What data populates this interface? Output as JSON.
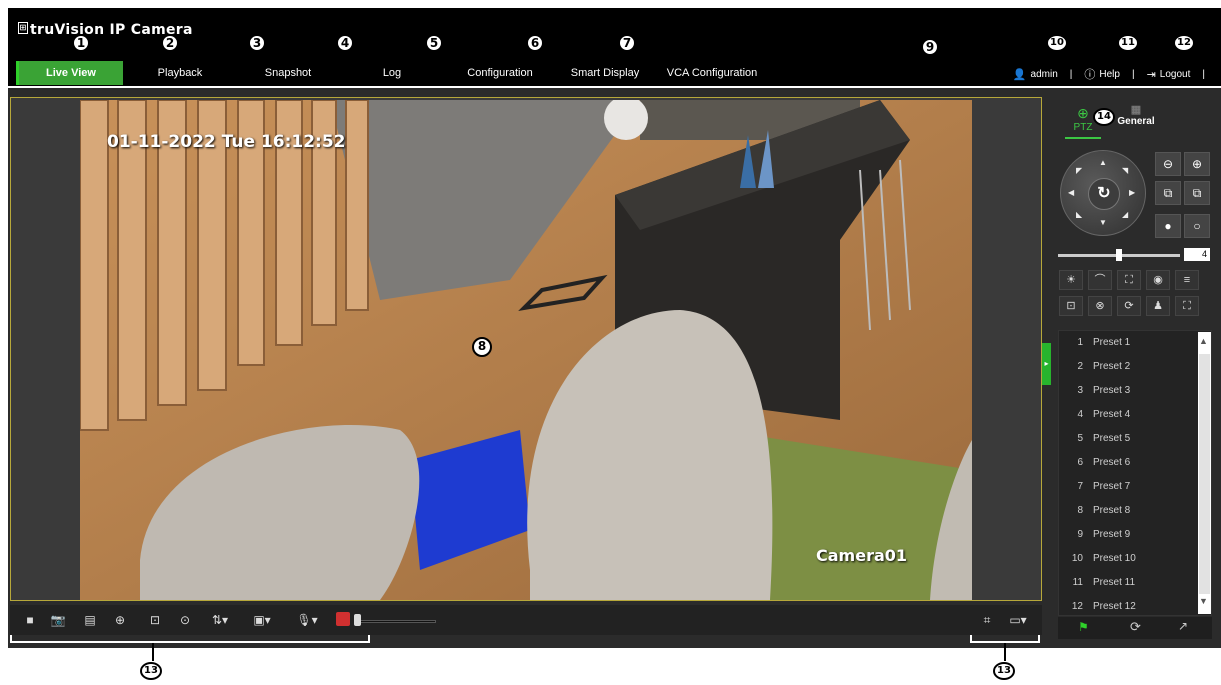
{
  "app": {
    "title": "truVision  IP Camera"
  },
  "nav": {
    "items": [
      "Live View",
      "Playback",
      "Snapshot",
      "Log",
      "Configuration",
      "Smart Display",
      "VCA Configuration"
    ]
  },
  "user": {
    "name": "admin",
    "help": "Help",
    "logout": "Logout",
    "separator": "|"
  },
  "callouts": [
    "1",
    "2",
    "3",
    "4",
    "5",
    "6",
    "7",
    "8",
    "9",
    "10",
    "11",
    "12",
    "13",
    "13",
    "14"
  ],
  "osd": {
    "timestamp": "01-11-2022 Tue 16:12:52",
    "camera_name": "Camera01"
  },
  "ptz": {
    "tabs": [
      "PTZ",
      "General"
    ],
    "speed": "4"
  },
  "presets": [
    {
      "num": "1",
      "name": "Preset 1"
    },
    {
      "num": "2",
      "name": "Preset 2"
    },
    {
      "num": "3",
      "name": "Preset 3"
    },
    {
      "num": "4",
      "name": "Preset 4"
    },
    {
      "num": "5",
      "name": "Preset 5"
    },
    {
      "num": "6",
      "name": "Preset 6"
    },
    {
      "num": "7",
      "name": "Preset 7"
    },
    {
      "num": "8",
      "name": "Preset 8"
    },
    {
      "num": "9",
      "name": "Preset 9"
    },
    {
      "num": "10",
      "name": "Preset 10"
    },
    {
      "num": "11",
      "name": "Preset 11"
    },
    {
      "num": "12",
      "name": "Preset 12"
    }
  ],
  "colors": {
    "accent": "#3aa335",
    "highlight": "#3cc744"
  },
  "icons": {
    "toolbar_left": [
      "stop-icon",
      "snapshot-icon",
      "record-icon",
      "digital-zoom-icon",
      "3d-position-icon",
      "focus-icon",
      "stream-select-icon",
      "play-mode-icon",
      "microphone-icon",
      "volume-icon"
    ],
    "toolbar_right": [
      "crop-icon",
      "window-size-icon"
    ]
  }
}
